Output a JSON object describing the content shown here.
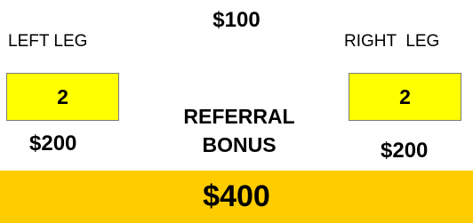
{
  "center_amount": "$100",
  "left_leg": {
    "label": "LEFT LEG",
    "count": "2",
    "amount": "$200"
  },
  "right_leg": {
    "label": "RIGHT  LEG",
    "count": "2",
    "amount": "$200"
  },
  "bonus": {
    "line1": "REFERRAL",
    "line2": "BONUS"
  },
  "total": "$400",
  "colors": {
    "count_box_fill": "#ffff00",
    "total_bar_fill": "#ffcc00",
    "border": "#7a7a7a",
    "text": "#000000"
  }
}
